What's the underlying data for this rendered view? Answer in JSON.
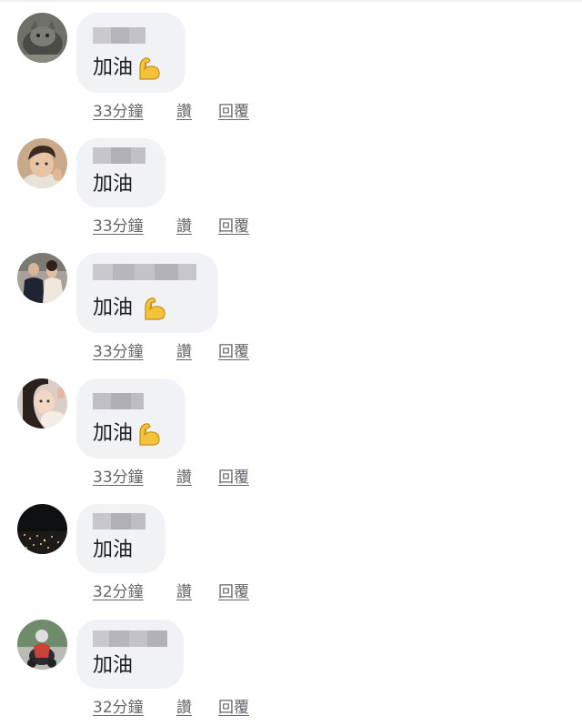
{
  "comments": [
    {
      "text": "加油",
      "emoji": "flexed-biceps",
      "time": "33分鐘",
      "like": "讚",
      "reply": "回覆"
    },
    {
      "text": "加油",
      "emoji": "",
      "time": "33分鐘",
      "like": "讚",
      "reply": "回覆"
    },
    {
      "text": "加油",
      "emoji": "flexed-biceps",
      "time": "33分鐘",
      "like": "讚",
      "reply": "回覆"
    },
    {
      "text": "加油",
      "emoji": "flexed-biceps",
      "time": "33分鐘",
      "like": "讚",
      "reply": "回覆"
    },
    {
      "text": "加油",
      "emoji": "",
      "time": "32分鐘",
      "like": "讚",
      "reply": "回覆"
    },
    {
      "text": "加油",
      "emoji": "",
      "time": "32分鐘",
      "like": "讚",
      "reply": "回覆"
    }
  ],
  "colors": {
    "bubble": "#f0f2f5",
    "meta_text": "#65676b",
    "body_text": "#1c1e21",
    "emoji": "#f5c33b"
  }
}
